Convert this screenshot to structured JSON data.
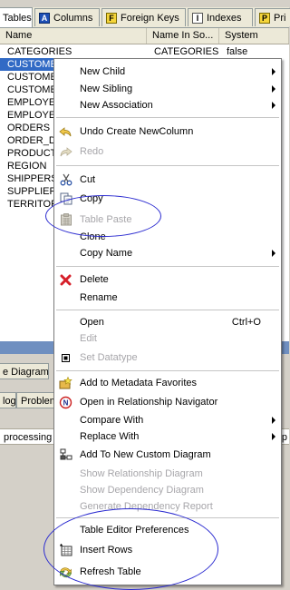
{
  "tabs": [
    {
      "label": "Tables",
      "icon": "none",
      "active": true
    },
    {
      "label": "Columns",
      "icon": "columns-icon"
    },
    {
      "label": "Foreign Keys",
      "icon": "foreign-keys-icon"
    },
    {
      "label": "Indexes",
      "icon": "indexes-icon"
    },
    {
      "label": "Pri",
      "icon": "primary-keys-icon"
    }
  ],
  "grid": {
    "headers": [
      "Name",
      "Name In So...",
      "System"
    ],
    "rows": [
      [
        "CATEGORIES",
        "CATEGORIES",
        "false"
      ],
      [
        "CUSTOMER",
        "",
        ""
      ],
      [
        "CUSTOMER",
        "",
        ""
      ],
      [
        "CUSTOMER",
        "",
        ""
      ],
      [
        "EMPLOYEE",
        "",
        ""
      ],
      [
        "EMPLOYEE",
        "",
        ""
      ],
      [
        "ORDERS",
        "",
        ""
      ],
      [
        "ORDER_DE",
        "",
        ""
      ],
      [
        "PRODUCTS",
        "",
        ""
      ],
      [
        "REGION",
        "",
        ""
      ],
      [
        "SHIPPERS",
        "",
        ""
      ],
      [
        "SUPPLIERS",
        "",
        ""
      ],
      [
        "TERRITOR",
        "",
        ""
      ]
    ]
  },
  "bottom": {
    "diagram_tab": "e Diagram",
    "log_tab": "log",
    "problems_tab": "Problem",
    "processing_text": "processing c",
    "right_fragment": "xp"
  },
  "menu": {
    "new_child": "New Child",
    "new_sibling": "New Sibling",
    "new_association": "New Association",
    "undo": "Undo Create NewColumn",
    "redo": "Redo",
    "cut": "Cut",
    "copy": "Copy",
    "table_paste": "Table Paste",
    "clone": "Clone",
    "copy_name": "Copy Name",
    "delete": "Delete",
    "rename": "Rename",
    "open": "Open",
    "open_shortcut": "Ctrl+O",
    "edit": "Edit",
    "set_datatype": "Set Datatype",
    "add_favorites": "Add to Metadata Favorites",
    "open_navigator": "Open in Relationship Navigator",
    "compare_with": "Compare With",
    "replace_with": "Replace With",
    "add_custom_diagram": "Add To New Custom Diagram",
    "show_relationship": "Show Relationship Diagram",
    "show_dependency": "Show Dependency Diagram",
    "generate_report": "Generate Dependency Report",
    "table_editor_prefs": "Table Editor Preferences",
    "insert_rows": "Insert Rows",
    "refresh_table": "Refresh Table"
  },
  "colors": {
    "selection": "#316ac5",
    "annotation": "#2b2bd0",
    "disabled": "#a7a6aa"
  }
}
